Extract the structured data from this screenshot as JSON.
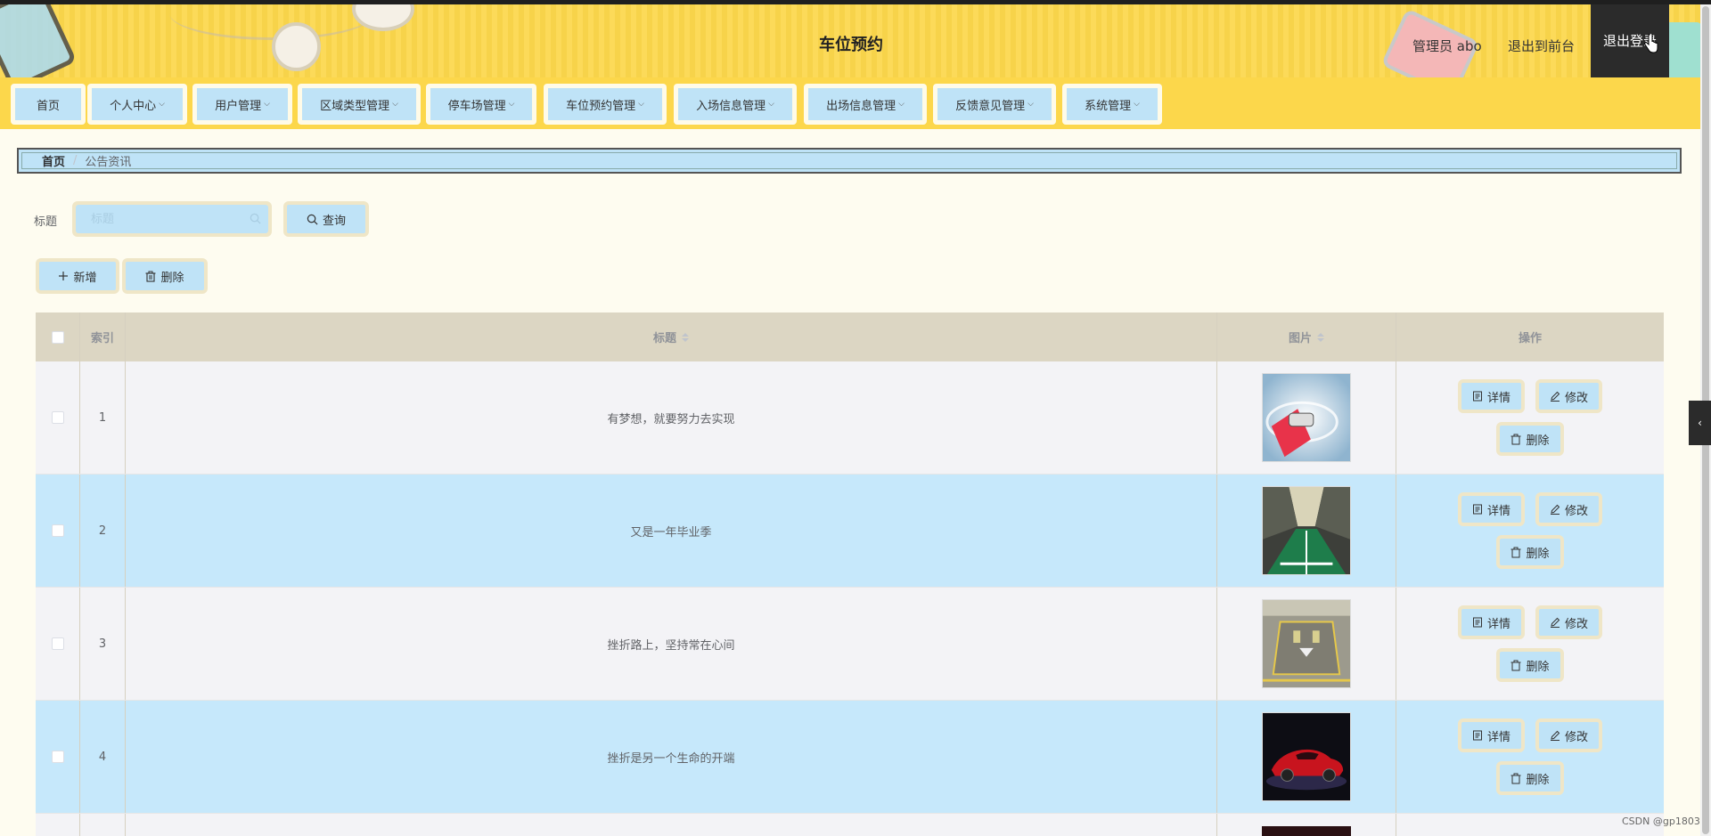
{
  "header": {
    "title": "车位预约",
    "admin_label": "管理员 abo",
    "back_to_front": "退出到前台",
    "logout": "退出登录"
  },
  "nav": [
    {
      "label": "首页",
      "dropdown": false
    },
    {
      "label": "个人中心",
      "dropdown": true
    },
    {
      "label": "用户管理",
      "dropdown": true
    },
    {
      "label": "区域类型管理",
      "dropdown": true
    },
    {
      "label": "停车场管理",
      "dropdown": true
    },
    {
      "label": "车位预约管理",
      "dropdown": true
    },
    {
      "label": "入场信息管理",
      "dropdown": true
    },
    {
      "label": "出场信息管理",
      "dropdown": true
    },
    {
      "label": "反馈意见管理",
      "dropdown": true
    },
    {
      "label": "系统管理",
      "dropdown": true
    }
  ],
  "breadcrumb": {
    "home": "首页",
    "current": "公告资讯"
  },
  "search": {
    "label": "标题",
    "placeholder": "标题",
    "button": "查询"
  },
  "actions": {
    "add": "新增",
    "delete": "删除"
  },
  "table": {
    "columns": {
      "index": "索引",
      "title": "标题",
      "image": "图片",
      "ops": "操作"
    },
    "rows": [
      {
        "index": "1",
        "title": "有梦想，就要努力去实现",
        "image": "car-on-snow-photo"
      },
      {
        "index": "2",
        "title": "又是一年毕业季",
        "image": "underground-garage-photo"
      },
      {
        "index": "3",
        "title": "挫折路上，坚持常在心间",
        "image": "parking-space-photo"
      },
      {
        "index": "4",
        "title": "挫折是另一个生命的开端",
        "image": "red-sports-car-photo"
      }
    ],
    "op_labels": {
      "detail": "详情",
      "edit": "修改",
      "delete": "删除"
    }
  },
  "watermark": "CSDN @gp1803",
  "colors": {
    "header_yellow": "#fcd74b",
    "button_blue": "#bfe3f7",
    "button_frame": "#efe6c7",
    "row_blue": "#c6e8fb",
    "table_header": "#dcd6c3"
  }
}
